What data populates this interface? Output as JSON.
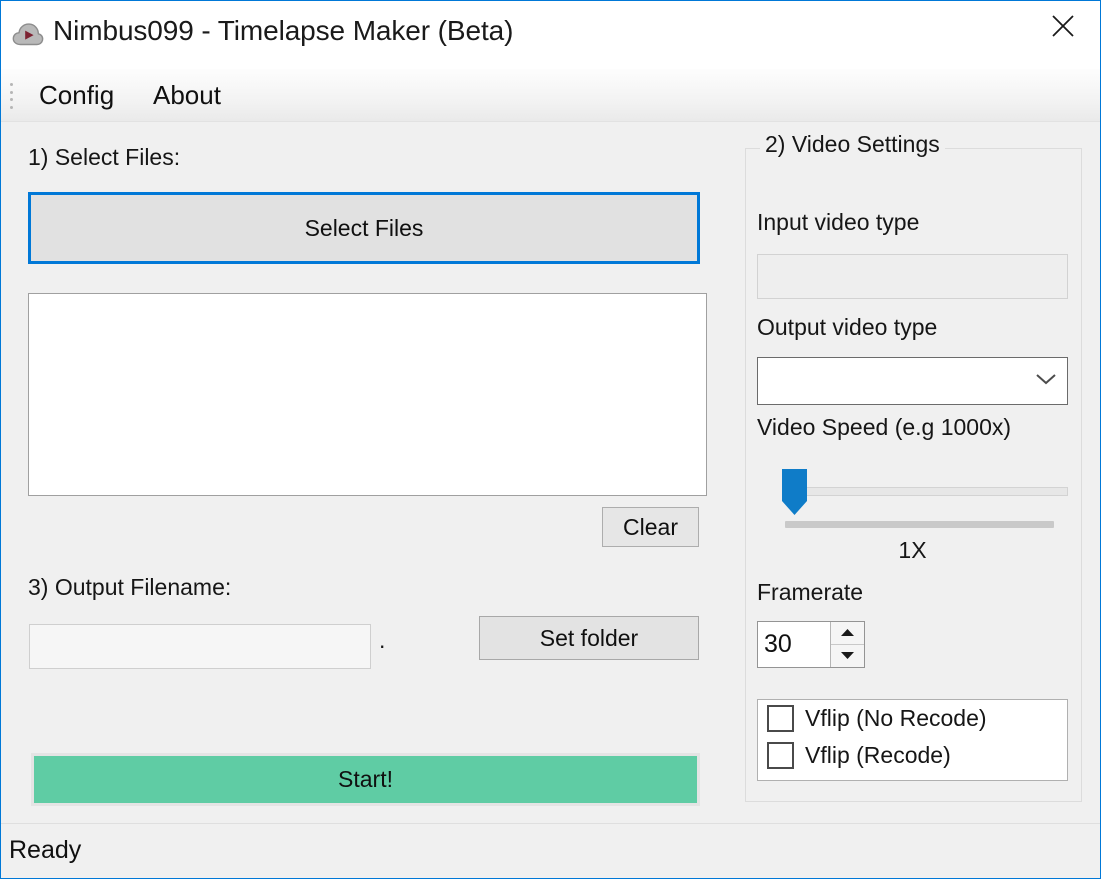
{
  "window": {
    "title": "Nimbus099 - Timelapse Maker (Beta)",
    "app_icon": "cloud-play-icon",
    "close_icon": "close-icon",
    "border_color": "#0078d7"
  },
  "menu": {
    "grip": "drag-grip-icon",
    "items": [
      {
        "label": "Config"
      },
      {
        "label": "About"
      }
    ]
  },
  "left_panel": {
    "select_files_label": "1) Select Files:",
    "select_files_button": "Select Files",
    "file_list_items": [],
    "clear_button": "Clear",
    "output_filename_label": "3) Output Filename:",
    "output_filename_value": "",
    "output_filename_placeholder": "",
    "filename_dot": ".",
    "set_folder_button": "Set folder",
    "start_button": "Start!",
    "start_button_color": "#5fcca4",
    "focus_color": "#0078d7"
  },
  "video_settings": {
    "legend": "2) Video Settings",
    "input_video_type_label": "Input video type",
    "input_video_type_value": "",
    "output_video_type_label": "Output video type",
    "output_video_type_value": "",
    "output_video_type_options": [],
    "combo_chevron_icon": "chevron-down-icon",
    "video_speed_label": "Video Speed (e.g 1000x)",
    "video_speed_value": "1X",
    "video_speed_position_percent": 0,
    "slider_thumb_color": "#0f7cc8",
    "framerate_label": "Framerate",
    "framerate_value": "30",
    "spinner_up_icon": "arrow-up-icon",
    "spinner_down_icon": "arrow-down-icon",
    "checkboxes": [
      {
        "label": "Vflip (No Recode)",
        "checked": false
      },
      {
        "label": "Vflip (Recode)",
        "checked": false
      }
    ]
  },
  "status_bar": {
    "text": "Ready"
  }
}
